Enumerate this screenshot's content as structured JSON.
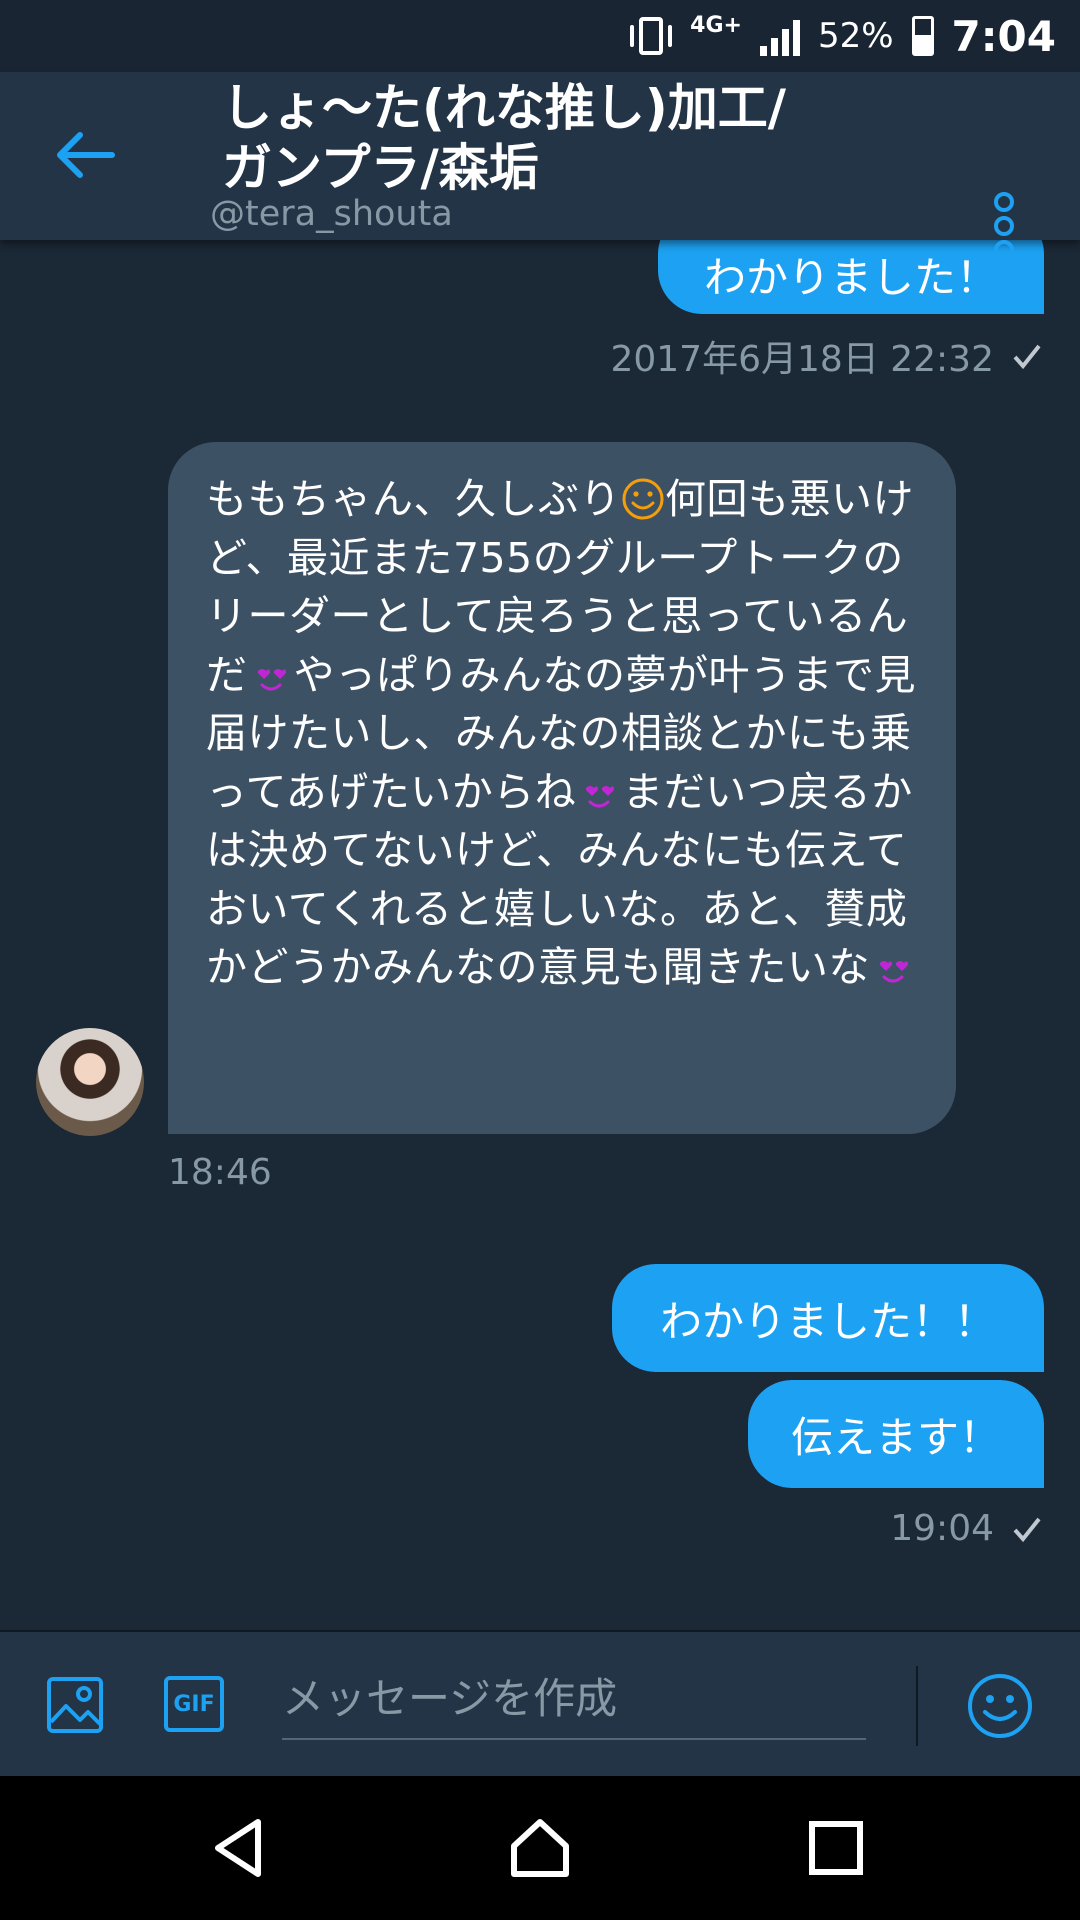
{
  "status_bar": {
    "network": "4G+",
    "battery_percent": "52%",
    "battery_level": 0.52,
    "time": "7:04"
  },
  "header": {
    "title": "しょ〜た(れな推し)加工/\nガンプラ/森垢",
    "handle": "@tera_shouta",
    "back_icon": "arrow-left-icon",
    "menu_icon": "more-vertical-icon"
  },
  "messages": {
    "top_out": {
      "text": "わかりました！",
      "meta": "2017年6月18日 22:32"
    },
    "incoming": {
      "part1": "ももちゃん、久しぶり",
      "part2": "何回も悪いけど、最近また755のグループトークのリーダーとして戻ろうと思っているんだ",
      "part3": "やっぱりみんなの夢が叶うまで見届けたいし、みんなの相談とかにも乗ってあげたいからね",
      "part4": "まだいつ戻るかは決めてないけど、みんなにも伝えておいてくれると嬉しいな。あと、賛成かどうかみんなの意見も聞きたいな",
      "time": "18:46"
    },
    "out1": {
      "text": "わかりました！！"
    },
    "out2": {
      "text": "伝えます！",
      "meta": "19:04"
    }
  },
  "composer": {
    "placeholder": "メッセージを作成",
    "gif_label": "GIF",
    "image_icon": "image-icon",
    "emoji_icon": "emoji-icon"
  },
  "colors": {
    "accent": "#1da1f2",
    "background": "#1b2836",
    "incoming_bubble": "#3d5165",
    "muted_text": "#8899a6",
    "heart": "#c026d3",
    "smile": "#f59e0b"
  }
}
